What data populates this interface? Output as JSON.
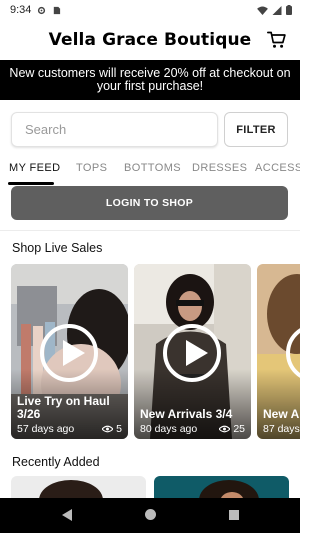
{
  "status_bar": {
    "time": "9:34",
    "icons": [
      "settings-icon",
      "sim-card-icon",
      "wifi-icon",
      "signal-icon",
      "battery-icon"
    ]
  },
  "header": {
    "title": "Vella Grace Boutique",
    "cart_icon": "cart-icon"
  },
  "promo": {
    "text": "New customers will receive 20% off at checkout on your first purchase!"
  },
  "search": {
    "placeholder": "Search",
    "value": "",
    "filter_label": "FILTER"
  },
  "tabs": [
    {
      "label": "MY FEED",
      "active": true
    },
    {
      "label": "TOPS",
      "active": false
    },
    {
      "label": "BOTTOMS",
      "active": false
    },
    {
      "label": "DRESSES",
      "active": false
    },
    {
      "label": "ACCESSO",
      "active": false
    }
  ],
  "login": {
    "label": "LOGIN TO SHOP"
  },
  "live_sales": {
    "title": "Shop Live Sales",
    "items": [
      {
        "title": "Live Try on Haul 3/26",
        "age": "57 days ago",
        "views": "5"
      },
      {
        "title": "New Arrivals 3/4",
        "age": "80 days ago",
        "views": "25"
      },
      {
        "title": "New Ar",
        "age": "87 days",
        "views": ""
      }
    ]
  },
  "recently_added": {
    "title": "Recently Added"
  },
  "nav_bar": {
    "icons": [
      "back-icon",
      "home-icon",
      "recents-icon"
    ]
  },
  "colors": {
    "promo_bg": "#000000",
    "login_bg": "#5f5f5f",
    "accent": "#000000"
  }
}
